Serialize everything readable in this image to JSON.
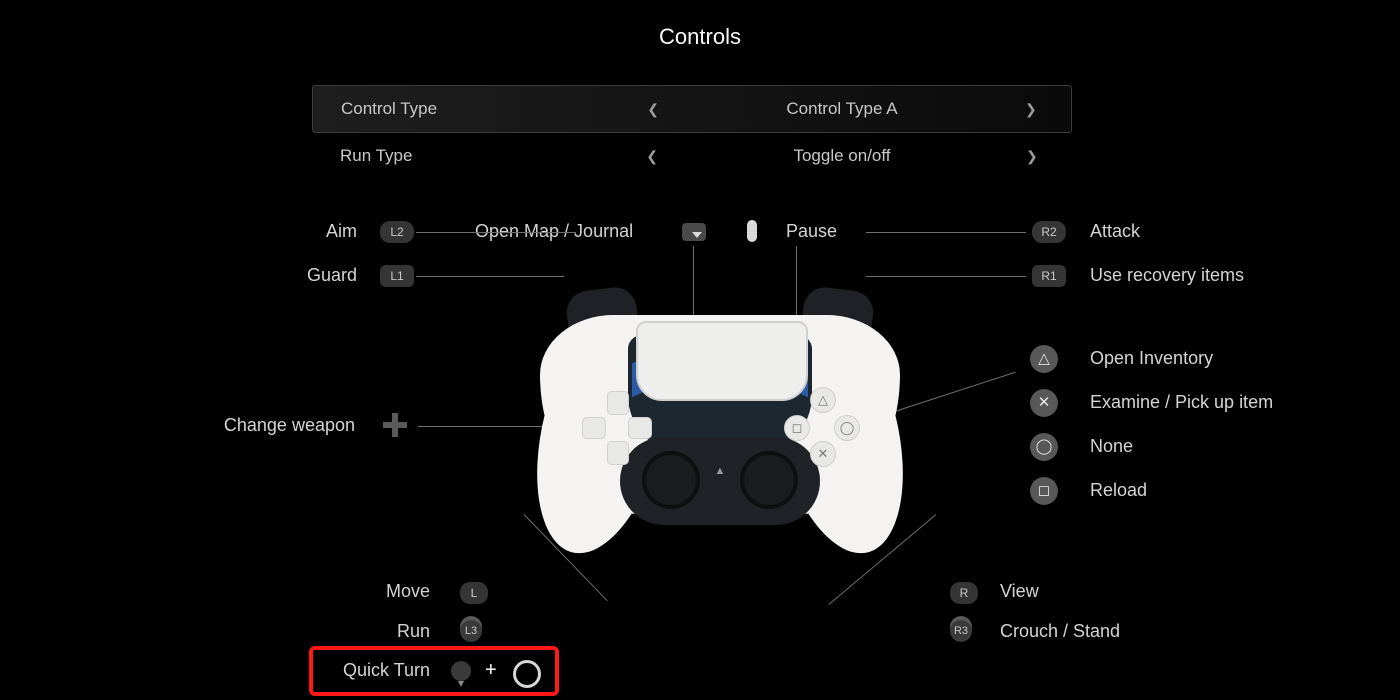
{
  "title": "Controls",
  "options": [
    {
      "label": "Control Type",
      "value": "Control Type A",
      "selected": true
    },
    {
      "label": "Run Type",
      "value": "Toggle on/off",
      "selected": false
    }
  ],
  "left": {
    "aim": "Aim",
    "guard": "Guard",
    "change_weapon": "Change weapon",
    "move": "Move",
    "run": "Run",
    "quick_turn": "Quick Turn"
  },
  "center": {
    "open_map": "Open Map / Journal",
    "pause": "Pause"
  },
  "right": {
    "attack": "Attack",
    "use_recovery": "Use recovery items",
    "triangle": "Open Inventory",
    "cross": "Examine / Pick up item",
    "circle": "None",
    "square": "Reload",
    "view": "View",
    "crouch": "Crouch / Stand"
  },
  "badges": {
    "l2": "L2",
    "l1": "L1",
    "r2": "R2",
    "r1": "R1",
    "l": "L",
    "l3": "L3",
    "r": "R",
    "r3": "R3"
  },
  "combo_plus": "+"
}
